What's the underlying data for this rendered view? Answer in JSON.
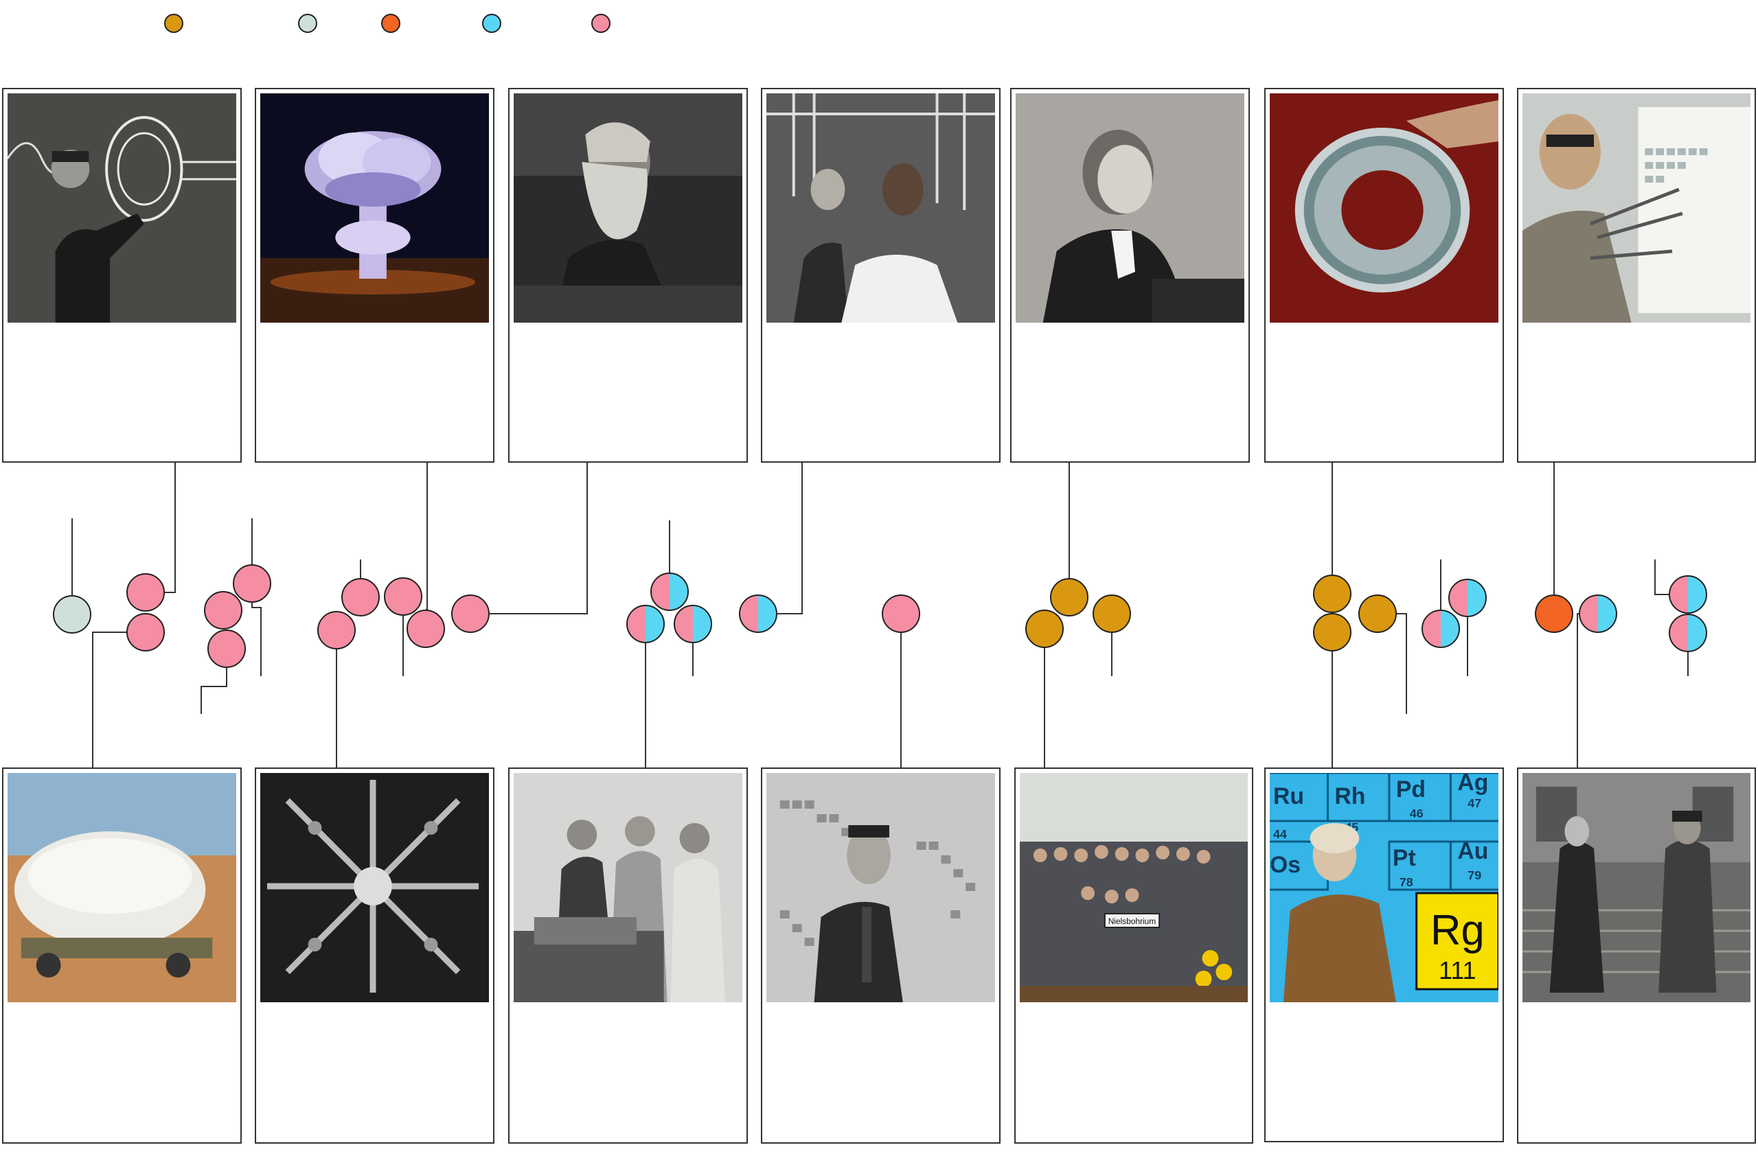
{
  "colors": {
    "orange": "#d9980f",
    "grey": "#cfe0da",
    "red_orange": "#f26522",
    "cyan": "#5ad6f5",
    "pink": "#f58ea3"
  },
  "legend": [
    {
      "color": "orange"
    },
    {
      "color": "grey"
    },
    {
      "color": "red_orange"
    },
    {
      "color": "cyan"
    },
    {
      "color": "pink"
    }
  ],
  "top_cards": [
    {
      "icon": "scientist-at-chalkboard-photo"
    },
    {
      "icon": "mushroom-cloud-photo"
    },
    {
      "icon": "bearded-chemist-photo"
    },
    {
      "icon": "scientists-in-lab-photo"
    },
    {
      "icon": "woman-physicist-photo"
    },
    {
      "icon": "accelerator-ring-photo"
    },
    {
      "icon": "press-conference-periodic-table-photo"
    }
  ],
  "bottom_cards": [
    {
      "icon": "bomb-casing-photo"
    },
    {
      "icon": "detector-apparatus-photo"
    },
    {
      "icon": "scientists-with-equipment-photo"
    },
    {
      "icon": "man-before-element-chart-photo"
    },
    {
      "icon": "group-with-nielsbohrium-sign-photo"
    },
    {
      "icon": "woman-with-rg-111-photo",
      "visible_text": [
        "Ru",
        "Rh",
        "Pd",
        "Ag",
        "44",
        "45",
        "46",
        "47",
        "Os",
        "Pt",
        "Au",
        "78",
        "79",
        "Rg",
        "111"
      ]
    },
    {
      "icon": "two-men-on-steps-photo"
    }
  ],
  "element_circles": [
    {
      "colors": [
        "grey"
      ]
    },
    {
      "colors": [
        "pink"
      ]
    },
    {
      "colors": [
        "pink"
      ]
    },
    {
      "colors": [
        "pink"
      ]
    },
    {
      "colors": [
        "pink"
      ]
    },
    {
      "colors": [
        "pink"
      ]
    },
    {
      "colors": [
        "pink"
      ]
    },
    {
      "colors": [
        "pink"
      ]
    },
    {
      "colors": [
        "pink"
      ]
    },
    {
      "colors": [
        "pink"
      ]
    },
    {
      "colors": [
        "pink"
      ]
    },
    {
      "colors": [
        "pink",
        "cyan"
      ]
    },
    {
      "colors": [
        "pink",
        "cyan"
      ]
    },
    {
      "colors": [
        "pink",
        "cyan"
      ]
    },
    {
      "colors": [
        "pink",
        "cyan"
      ]
    },
    {
      "colors": [
        "pink"
      ]
    },
    {
      "colors": [
        "orange"
      ]
    },
    {
      "colors": [
        "orange"
      ]
    },
    {
      "colors": [
        "orange"
      ]
    },
    {
      "colors": [
        "orange"
      ]
    },
    {
      "colors": [
        "orange"
      ]
    },
    {
      "colors": [
        "orange"
      ]
    },
    {
      "colors": [
        "pink",
        "cyan"
      ]
    },
    {
      "colors": [
        "pink",
        "cyan"
      ]
    },
    {
      "colors": [
        "red_orange"
      ]
    },
    {
      "colors": [
        "pink",
        "cyan"
      ]
    },
    {
      "colors": [
        "pink",
        "cyan"
      ]
    },
    {
      "colors": [
        "pink",
        "cyan"
      ]
    }
  ],
  "photo_text": {
    "ru": "Ru",
    "rh": "Rh",
    "pd": "Pd",
    "ag": "Ag",
    "n44": "44",
    "n45": "45",
    "n46": "46",
    "n47": "47",
    "os": "Os",
    "pt": "Pt",
    "au": "Au",
    "n78": "78",
    "n79": "79",
    "rg": "Rg",
    "n111": "111",
    "sign": "Nielsbohrium"
  }
}
